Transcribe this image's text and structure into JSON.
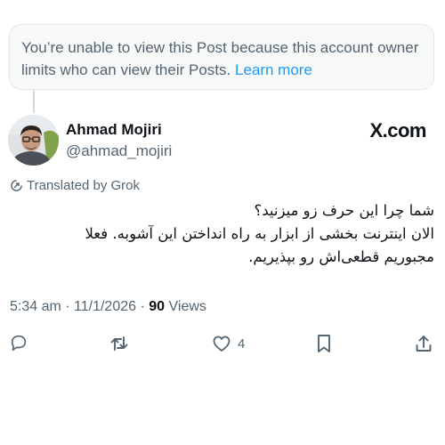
{
  "notice": {
    "text": "You’re unable to view this Post because this account owner limits who can view their Posts.",
    "link": "Learn more"
  },
  "author": {
    "name": "Ahmad Mojiri",
    "handle": "@ahmad_mojiri"
  },
  "source_label": "X.com",
  "translated_label": "Translated by Grok",
  "post": {
    "lines": [
      "شما چرا این حرف زو میزنید؟",
      "الان اینترنت بخشی از ابزار به راه انداختن این آشوبه. فعلا",
      "مجبوریم قطعی‌اش رو بپذیریم."
    ]
  },
  "meta": {
    "time": "5:34 am",
    "separator": " · ",
    "date": "11/1/2026",
    "views_count": "90",
    "views_label": "Views"
  },
  "actions": {
    "like_count": "4"
  },
  "icons": {
    "reply": "reply-icon",
    "repost": "repost-icon",
    "like": "heart-icon",
    "bookmark": "bookmark-icon",
    "share": "share-icon",
    "translate": "translate-icon"
  },
  "colors": {
    "secondary_text": "#536471",
    "link": "#1d9bf0",
    "notice_bg": "#f7f9f9"
  }
}
